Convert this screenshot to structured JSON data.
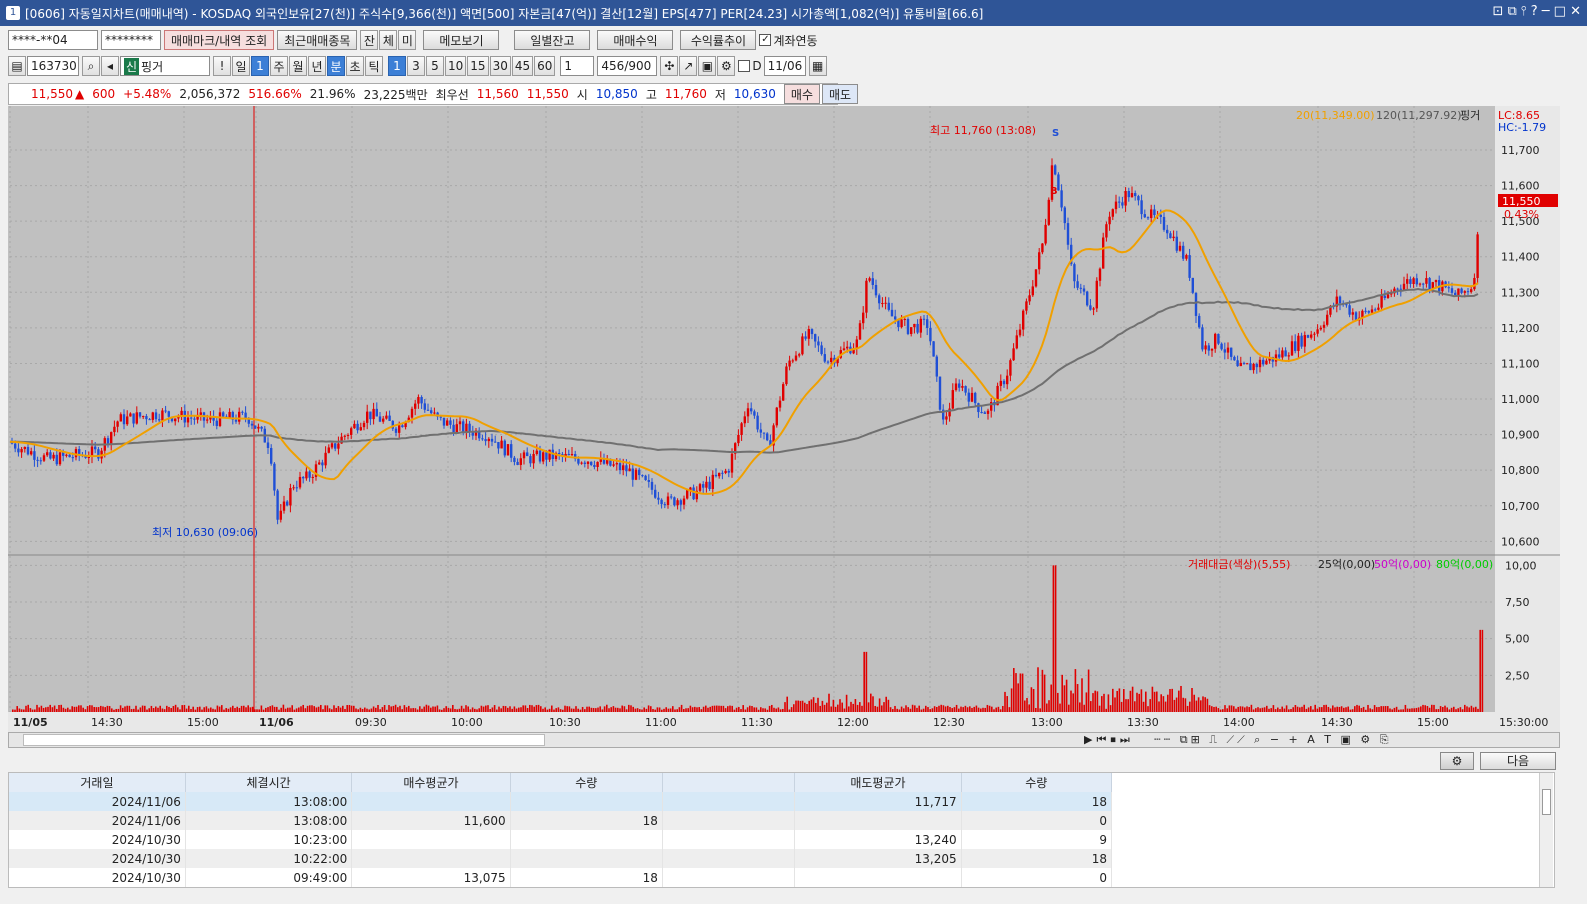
{
  "title": {
    "badge": "1",
    "text": "[0606] 자동일지차트(매매내역) - KOSDAQ 외국인보유[27(천)] 주식수[9,366(천)] 액면[500] 자본금[47(억)] 결산[12월] EPS[477] PER[24.23] 시가총액[1,082(억)] 유통비율[66.6]",
    "controls": "⊡ ⧉ ⫯ ? ─ □ ✕"
  },
  "toolbar1": {
    "account": "****-**04",
    "password": "********",
    "btn_mark": "매매마크/내역 조회",
    "btn_recent": "최근매매종목",
    "tab_jan": "잔",
    "tab_che": "체",
    "tab_mi": "미",
    "btn_memo": "메모보기",
    "btn_daily": "일별잔고",
    "btn_profit": "매매수익",
    "btn_rate": "수익률추이",
    "chk_link": "계좌연동"
  },
  "toolbar2": {
    "code": "163730",
    "shin": "신",
    "name": "핑거",
    "day": "일",
    "period_val": "1",
    "week": "주",
    "month": "월",
    "year": "년",
    "minute": "분",
    "second": "초",
    "tick": "틱",
    "intervals": [
      "1",
      "3",
      "5",
      "10",
      "15",
      "30",
      "45",
      "60"
    ],
    "custom": "1",
    "count": "456",
    "count_max": "/900",
    "date_label": "D",
    "date": "11/06"
  },
  "quote": {
    "price": "11,550",
    "arrow": "▲",
    "change": "600",
    "pct": "+5.48%",
    "volume": "2,056,372",
    "ratio": "516.66%",
    "turnover": "21.96%",
    "amount": "23,225백만",
    "best_label": "최우선",
    "best_ask": "11,560",
    "best_bid": "11,550",
    "open_label": "시",
    "open": "10,850",
    "high_label": "고",
    "high": "11,760",
    "low_label": "저",
    "low": "10,630",
    "buy": "매수",
    "sell": "매도"
  },
  "chart_data": {
    "type": "candlestick",
    "legend": {
      "ma20": "20(11,349.00)",
      "ma120": "120(11,297.92)",
      "name": "핑거"
    },
    "lc": "LC:8.65",
    "hc": "HC:-1.79",
    "price_tag": "11,550",
    "pct_tag": "0.43%",
    "high_marker": "최고 11,760 (13:08)",
    "low_marker": "최저 10,630 (09:06)",
    "price_ticks": [
      "11,700",
      "11,600",
      "11,500",
      "11,400",
      "11,300",
      "11,200",
      "11,100",
      "11,000",
      "10,900",
      "10,800",
      "10,700",
      "10,600"
    ],
    "vol_legend": {
      "a": "거래대금(색상)(5,55)",
      "b": "25억(0,00)",
      "c": "50억(0,00)",
      "d": "80억(0,00)"
    },
    "vol_ticks": [
      "10,00",
      "7,50",
      "5,00",
      "2,50"
    ],
    "time_ticks": [
      "11/05",
      "14:30",
      "15:00",
      "11/06",
      "09:30",
      "10:00",
      "10:30",
      "11:00",
      "11:30",
      "12:00",
      "12:30",
      "13:00",
      "13:30",
      "14:00",
      "14:30",
      "15:00"
    ],
    "time_end": "15:30:00",
    "ylim": [
      10570,
      11790
    ],
    "vol_max": 10.5,
    "colors": {
      "up": "#e00000",
      "down": "#1f4fd6",
      "ma20": "#f0a000",
      "ma120": "#707070",
      "bg": "#c0c0c0"
    }
  },
  "bottom": {
    "next": "다음",
    "headers": [
      "거래일",
      "체결시간",
      "매수평균가",
      "수량",
      "",
      "매도평균가",
      "수량"
    ],
    "rows": [
      [
        "2024/11/06",
        "13:08:00",
        "",
        "",
        "",
        "11,717",
        "18"
      ],
      [
        "2024/11/06",
        "13:08:00",
        "11,600",
        "18",
        "",
        "",
        "0"
      ],
      [
        "2024/10/30",
        "10:23:00",
        "",
        "",
        "",
        "13,240",
        "9"
      ],
      [
        "2024/10/30",
        "10:22:00",
        "",
        "",
        "",
        "13,205",
        "18"
      ],
      [
        "2024/10/30",
        "09:49:00",
        "13,075",
        "18",
        "",
        "",
        "0"
      ]
    ]
  }
}
